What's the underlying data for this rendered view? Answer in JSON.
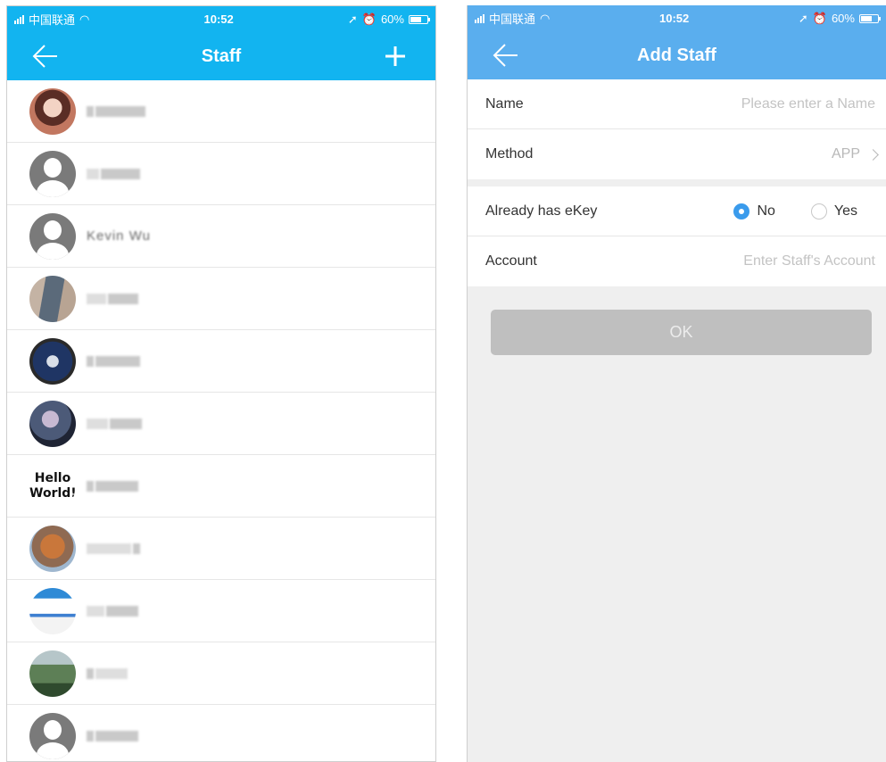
{
  "status_bar": {
    "carrier": "中国联通",
    "time": "10:52",
    "battery": "60%"
  },
  "staff_screen": {
    "title": "Staff",
    "items": [
      {
        "avatar": "photo-woman"
      },
      {
        "avatar": "default"
      },
      {
        "avatar": "default",
        "name": "Kevin Wu"
      },
      {
        "avatar": "photo-building"
      },
      {
        "avatar": "photo-logo"
      },
      {
        "avatar": "photo-sunset"
      },
      {
        "avatar": "text",
        "avatar_text": [
          "Hello",
          "World!"
        ]
      },
      {
        "avatar": "photo-tree"
      },
      {
        "avatar": "photo-screenshot"
      },
      {
        "avatar": "photo-mountain"
      },
      {
        "avatar": "default"
      }
    ]
  },
  "add_staff_screen": {
    "title": "Add Staff",
    "name_label": "Name",
    "name_placeholder": "Please enter a Name",
    "method_label": "Method",
    "method_value": "APP",
    "ekey_label": "Already has eKey",
    "ekey_no": "No",
    "ekey_yes": "Yes",
    "ekey_selected": "No",
    "account_label": "Account",
    "account_placeholder": "Enter Staff's Account",
    "ok_label": "OK"
  },
  "colors": {
    "header_left": "#12b4f0",
    "header_right": "#5aaeee",
    "radio_active": "#3a9bec",
    "button_disabled": "#bfbfbf"
  }
}
